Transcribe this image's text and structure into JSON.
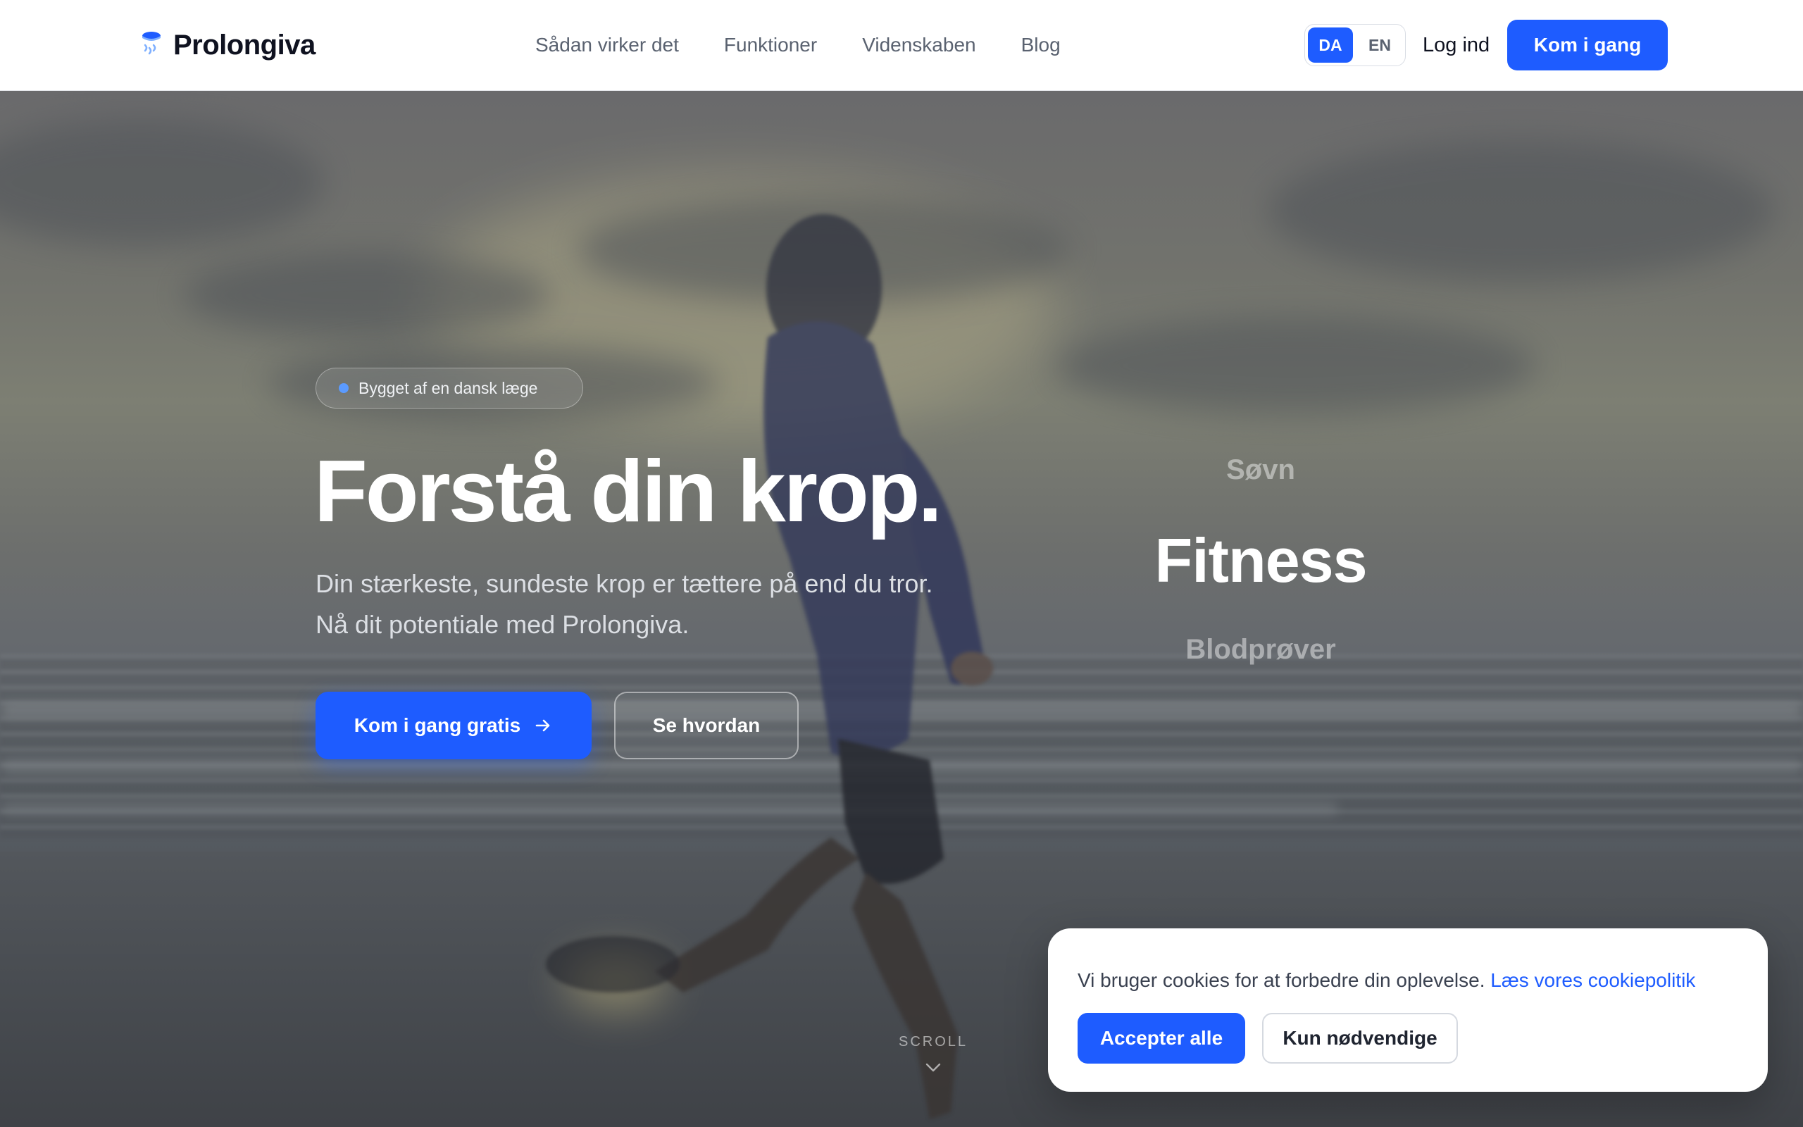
{
  "brand": {
    "name": "Prolongiva",
    "logo_icon": "droplet-logo-icon",
    "accent": "#1e5cff"
  },
  "nav": {
    "items": [
      {
        "label": "Sådan virker det"
      },
      {
        "label": "Funktioner"
      },
      {
        "label": "Videnskaben"
      },
      {
        "label": "Blog"
      }
    ]
  },
  "language": {
    "options": [
      "DA",
      "EN"
    ],
    "selected": "DA"
  },
  "header": {
    "login_label": "Log ind",
    "cta_label": "Kom i gang"
  },
  "hero": {
    "badge": "Bygget af en dansk læge",
    "headline": "Forstå din krop.",
    "subtitle": "Din stærkeste, sundeste krop er tættere på end du tror. Nå dit potentiale med Prolongiva.",
    "primary_cta": "Kom i gang gratis",
    "secondary_cta": "Se hvordan",
    "rotating_words": {
      "previous": "Søvn",
      "current": "Fitness",
      "next": "Blodprøver"
    },
    "scroll_label": "SCROLL"
  },
  "cookie": {
    "message": "Vi bruger cookies for at forbedre din oplevelse.",
    "link_label": "Læs vores cookiepolitik",
    "accept_label": "Accepter alle",
    "necessary_label": "Kun nødvendige"
  }
}
